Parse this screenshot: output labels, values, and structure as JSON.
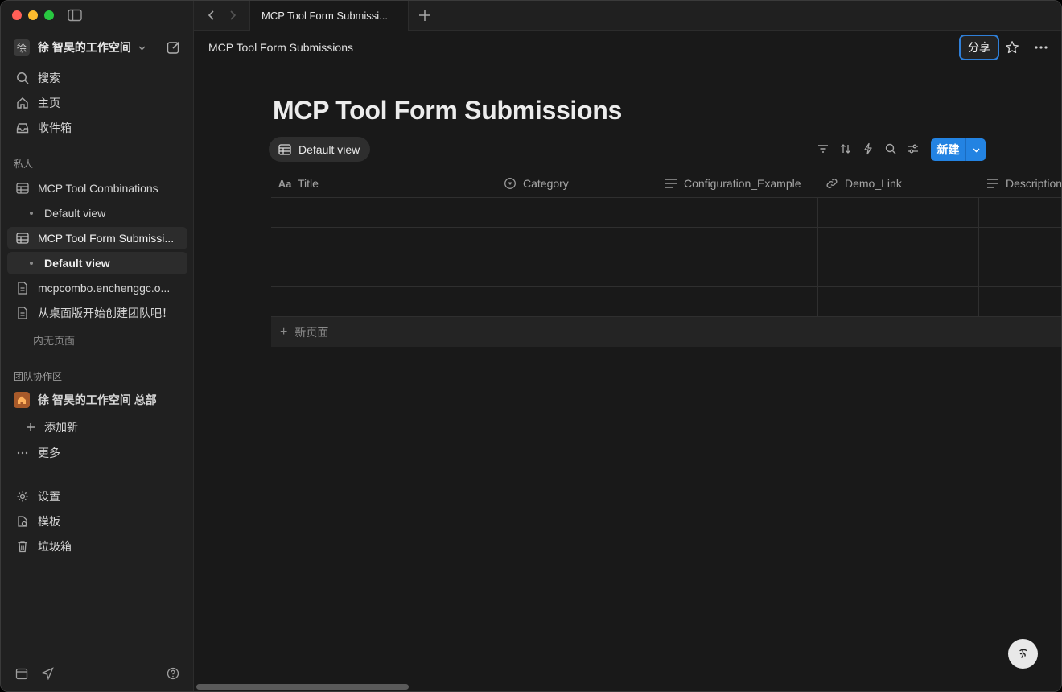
{
  "sidebar": {
    "workspace": {
      "avatar": "徐",
      "name": "徐 智昊的工作空间"
    },
    "top_items": [
      {
        "label": "搜索",
        "icon": "search-icon"
      },
      {
        "label": "主页",
        "icon": "home-icon"
      },
      {
        "label": "收件箱",
        "icon": "inbox-icon"
      }
    ],
    "private_label": "私人",
    "private_items": [
      {
        "label": "MCP Tool Combinations",
        "icon": "table-icon"
      },
      {
        "label": "Default view"
      },
      {
        "label": "MCP Tool Form Submissi...",
        "icon": "table-icon"
      },
      {
        "label": "Default view"
      },
      {
        "label": "mcpcombo.enchenggc.o...",
        "icon": "page-icon"
      },
      {
        "label": "从桌面版开始创建团队吧！",
        "icon": "page-icon"
      }
    ],
    "empty_label": "内无页面",
    "team_label": "团队协作区",
    "team_item": "徐 智昊的工作空间 总部",
    "add_new": "添加新",
    "more": "更多",
    "bottom_items": [
      {
        "label": "设置",
        "icon": "gear-icon"
      },
      {
        "label": "模板",
        "icon": "template-icon"
      },
      {
        "label": "垃圾箱",
        "icon": "trash-icon"
      }
    ]
  },
  "tabbar": {
    "tab_title": "MCP Tool Form Submissi..."
  },
  "header": {
    "breadcrumb": "MCP Tool Form Submissions",
    "share_label": "分享"
  },
  "page": {
    "title": "MCP Tool Form Submissions",
    "view_label": "Default view",
    "new_label": "新建",
    "columns": [
      {
        "label": "Title",
        "icon": "text-title-icon"
      },
      {
        "label": "Category",
        "icon": "select-icon"
      },
      {
        "label": "Configuration_Example",
        "icon": "text-icon"
      },
      {
        "label": "Demo_Link",
        "icon": "link-icon"
      },
      {
        "label": "Description",
        "icon": "text-icon"
      }
    ],
    "new_page_label": "新页面"
  },
  "colors": {
    "accent": "#2383e2",
    "sidebar_bg": "#202020",
    "main_bg": "#191919"
  }
}
